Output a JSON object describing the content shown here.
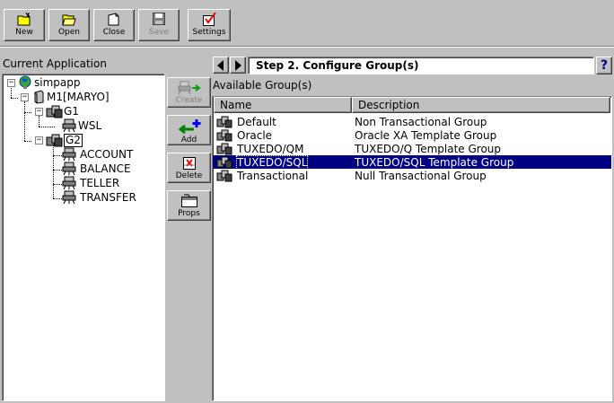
{
  "toolbar": {
    "new_label": "New",
    "open_label": "Open",
    "close_label": "Close",
    "save_label": "Save",
    "settings_label": "Settings"
  },
  "left_panel": {
    "title": "Current Application",
    "tree": {
      "root": "simpapp",
      "machine": "M1[MARYO]",
      "group1": "G1",
      "group1_server": "WSL",
      "group2": "G2",
      "group2_servers": [
        "ACCOUNT",
        "BALANCE",
        "TELLER",
        "TRANSFER"
      ]
    }
  },
  "side_buttons": {
    "create_label": "Create",
    "add_label": "Add",
    "delete_label": "Delete",
    "props_label": "Props"
  },
  "wizard": {
    "step_title": "Step 2. Configure Group(s)",
    "help_label": "?"
  },
  "groups": {
    "section_label": "Available Group(s)",
    "columns": [
      "Name",
      "Description"
    ],
    "rows": [
      {
        "name": "Default",
        "description": "Non Transactional Group"
      },
      {
        "name": "Oracle",
        "description": "Oracle XA Template Group"
      },
      {
        "name": "TUXEDO/QM",
        "description": "TUXEDO/Q Template Group"
      },
      {
        "name": "TUXEDO/SQL",
        "description": "TUXEDO/SQL Template Group"
      },
      {
        "name": "Transactional",
        "description": "Null Transactional Group"
      }
    ],
    "selected_index": 3
  },
  "colors": {
    "face": "#c0c0c0",
    "selection": "#000080",
    "add_arrow": "#008000",
    "add_plus": "#0000ff",
    "delete_x": "#ff0000"
  }
}
